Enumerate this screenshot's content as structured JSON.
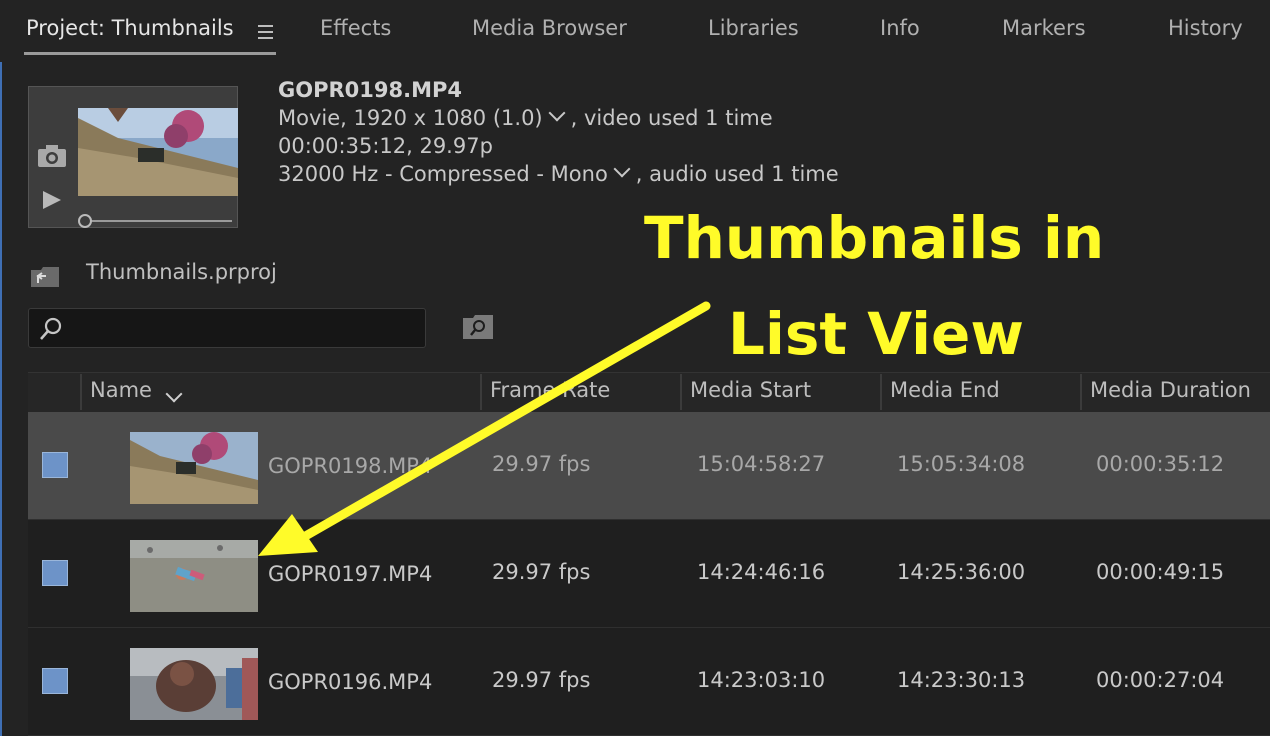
{
  "tabs": [
    {
      "label": "Project: Thumbnails"
    },
    {
      "label": "Effects"
    },
    {
      "label": "Media Browser"
    },
    {
      "label": "Libraries"
    },
    {
      "label": "Info"
    },
    {
      "label": "Markers"
    },
    {
      "label": "History"
    }
  ],
  "info": {
    "filename": "GOPR0198.MP4",
    "video_line_a": "Movie, 1920 x 1080 (1.0)",
    "video_line_b": ", video used 1 time",
    "timing": "00:00:35:12, 29.97p",
    "audio_line_a": "32000 Hz - Compressed - Mono",
    "audio_line_b": ", audio used 1 time"
  },
  "project": {
    "name": "Thumbnails.prproj"
  },
  "search": {
    "placeholder": ""
  },
  "table": {
    "columns": [
      "Name",
      "Frame Rate",
      "Media Start",
      "Media End",
      "Media Duration"
    ],
    "rows": [
      {
        "name": "GOPR0198.MP4",
        "frame_rate": "29.97 fps",
        "media_start": "15:04:58:27",
        "media_end": "15:05:34:08",
        "duration": "00:00:35:12"
      },
      {
        "name": "GOPR0197.MP4",
        "frame_rate": "29.97 fps",
        "media_start": "14:24:46:16",
        "media_end": "14:25:36:00",
        "duration": "00:00:49:15"
      },
      {
        "name": "GOPR0196.MP4",
        "frame_rate": "29.97 fps",
        "media_start": "14:23:03:10",
        "media_end": "14:23:30:13",
        "duration": "00:00:27:04"
      }
    ]
  },
  "annotation": {
    "line1": "Thumbnails in",
    "line2": "List View",
    "color": "#fffb29"
  },
  "colors": {
    "accent": "#3f6fb4",
    "label_swatch": "#6d93c8",
    "selected_row": "#4a4a4a"
  }
}
